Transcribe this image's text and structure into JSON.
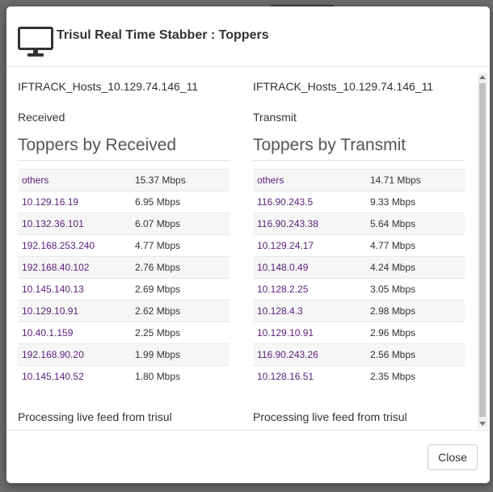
{
  "modal": {
    "title": "Trisul Real Time Stabber : Toppers",
    "close_label": "Close"
  },
  "received": {
    "host": "IFTRACK_Hosts_10.129.74.146_11",
    "direction": "Received",
    "heading": "Toppers by Received",
    "rows": [
      {
        "name": "others",
        "value": "15.37 Mbps"
      },
      {
        "name": "10.129.16.19",
        "value": "6.95 Mbps"
      },
      {
        "name": "10.132.36.101",
        "value": "6.07 Mbps"
      },
      {
        "name": "192.168.253.240",
        "value": "4.77 Mbps"
      },
      {
        "name": "192.168.40.102",
        "value": "2.76 Mbps"
      },
      {
        "name": "10.145.140.13",
        "value": "2.69 Mbps"
      },
      {
        "name": "10.129.10.91",
        "value": "2.62 Mbps"
      },
      {
        "name": "10.40.1.159",
        "value": "2.25 Mbps"
      },
      {
        "name": "192.168.90.20",
        "value": "1.99 Mbps"
      },
      {
        "name": "10.145.140.52",
        "value": "1.80 Mbps"
      }
    ],
    "feed_status": "Processing live feed from trisul"
  },
  "transmit": {
    "host": "IFTRACK_Hosts_10.129.74.146_11",
    "direction": "Transmit",
    "heading": "Toppers by Transmit",
    "rows": [
      {
        "name": "others",
        "value": "14.71 Mbps"
      },
      {
        "name": "116.90.243.5",
        "value": "9.33 Mbps"
      },
      {
        "name": "116.90.243.38",
        "value": "5.64 Mbps"
      },
      {
        "name": "10.129.24.17",
        "value": "4.77 Mbps"
      },
      {
        "name": "10.148.0.49",
        "value": "4.24 Mbps"
      },
      {
        "name": "10.128.2.25",
        "value": "3.05 Mbps"
      },
      {
        "name": "10.128.4.3",
        "value": "2.98 Mbps"
      },
      {
        "name": "10.129.10.91",
        "value": "2.96 Mbps"
      },
      {
        "name": "116.90.243.26",
        "value": "2.56 Mbps"
      },
      {
        "name": "10.128.16.51",
        "value": "2.35 Mbps"
      }
    ],
    "feed_status": "Processing live feed from trisul"
  },
  "colors": {
    "link": "#5a1e7a",
    "backdrop": "#6c6c6c"
  },
  "icons": {
    "header": "monitor-icon"
  }
}
